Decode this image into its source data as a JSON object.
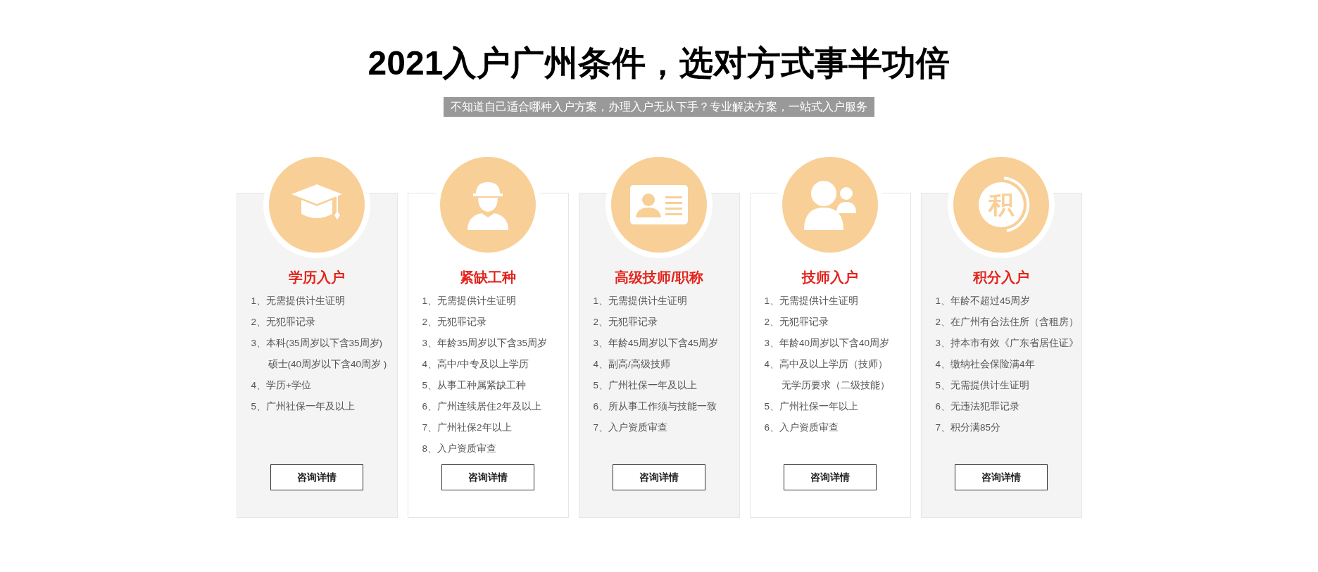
{
  "heading": "2021入户广州条件，选对方式事半功倍",
  "subtitle": "不知道自己适合哪种入户方案，办理入户无从下手？专业解决方案，一站式入户服务",
  "cards": [
    {
      "title": "学历入户",
      "button": "咨询详情",
      "items": [
        {
          "kind": "item",
          "text": "1、无需提供计生证明"
        },
        {
          "kind": "item",
          "text": "2、无犯罪记录"
        },
        {
          "kind": "item",
          "text": "3、本科(35周岁以下含35周岁)"
        },
        {
          "kind": "continued",
          "text": "硕士(40周岁以下含40周岁 )"
        },
        {
          "kind": "item",
          "text": "4、学历+学位"
        },
        {
          "kind": "item",
          "text": "5、广州社保一年及以上"
        }
      ]
    },
    {
      "title": "紧缺工种",
      "button": "咨询详情",
      "items": [
        {
          "kind": "item",
          "text": "1、无需提供计生证明"
        },
        {
          "kind": "item",
          "text": "2、无犯罪记录"
        },
        {
          "kind": "item",
          "text": "3、年龄35周岁以下含35周岁"
        },
        {
          "kind": "item",
          "text": "4、高中/中专及以上学历"
        },
        {
          "kind": "item",
          "text": "5、从事工种属紧缺工种"
        },
        {
          "kind": "item",
          "text": "6、广州连续居住2年及以上"
        },
        {
          "kind": "item",
          "text": "7、广州社保2年以上"
        },
        {
          "kind": "item",
          "text": "8、入户资质审查"
        }
      ]
    },
    {
      "title": "高级技师/职称",
      "button": "咨询详情",
      "items": [
        {
          "kind": "item",
          "text": "1、无需提供计生证明"
        },
        {
          "kind": "item",
          "text": "2、无犯罪记录"
        },
        {
          "kind": "item",
          "text": "3、年龄45周岁以下含45周岁"
        },
        {
          "kind": "item",
          "text": "4、副高/高级技师"
        },
        {
          "kind": "item",
          "text": "5、广州社保一年及以上"
        },
        {
          "kind": "item",
          "text": "6、所从事工作须与技能一致"
        },
        {
          "kind": "item",
          "text": "7、入户资质审查"
        }
      ]
    },
    {
      "title": "技师入户",
      "button": "咨询详情",
      "items": [
        {
          "kind": "item",
          "text": "1、无需提供计生证明"
        },
        {
          "kind": "item",
          "text": "2、无犯罪记录"
        },
        {
          "kind": "item",
          "text": "3、年龄40周岁以下含40周岁"
        },
        {
          "kind": "item",
          "text": "4、高中及以上学历（技师）"
        },
        {
          "kind": "continued",
          "text": "无学历要求（二级技能）"
        },
        {
          "kind": "item",
          "text": "5、广州社保一年以上"
        },
        {
          "kind": "item",
          "text": "6、入户资质审查"
        }
      ]
    },
    {
      "icon_label": "积",
      "title": "积分入户",
      "button": "咨询详情",
      "items": [
        {
          "kind": "item",
          "text": "1、年龄不超过45周岁"
        },
        {
          "kind": "item",
          "text": "2、在广州有合法住所（含租房）"
        },
        {
          "kind": "item",
          "text": "3、持本市有效《广东省居住证》"
        },
        {
          "kind": "item",
          "text": "4、缴纳社会保险满4年"
        },
        {
          "kind": "item",
          "text": "5、无需提供计生证明"
        },
        {
          "kind": "item",
          "text": "6、无违法犯罪记录"
        },
        {
          "kind": "item",
          "text": "7、积分满85分"
        }
      ]
    }
  ]
}
